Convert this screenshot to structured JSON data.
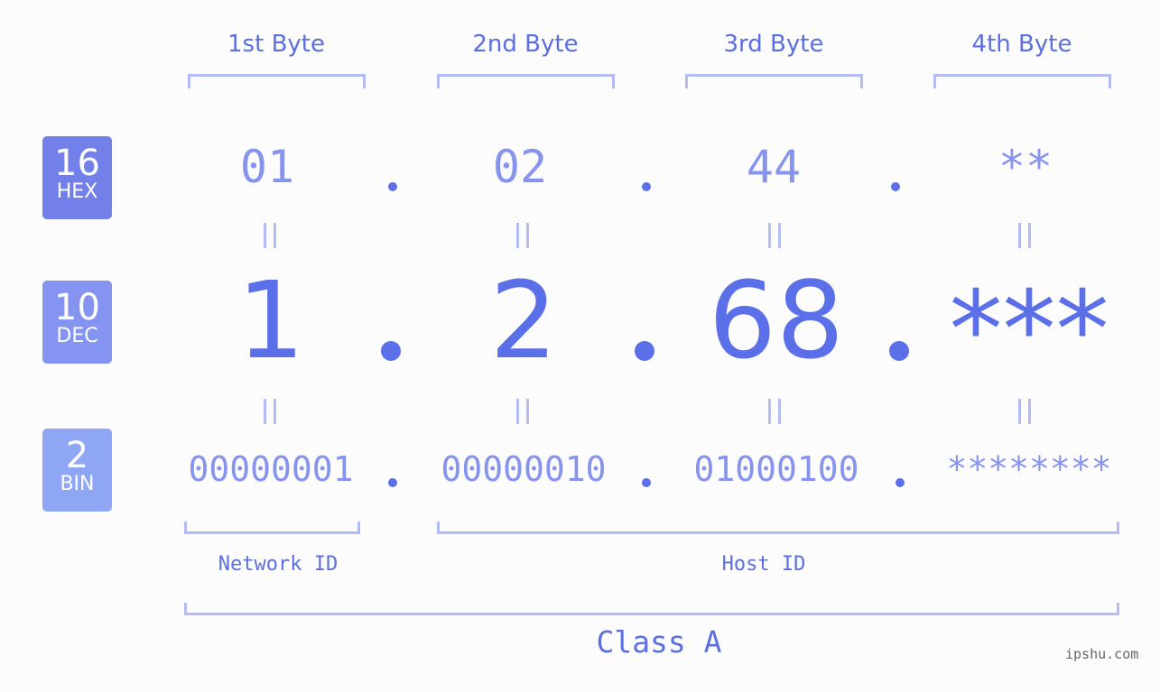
{
  "ip": {
    "hex": "01.02.44.**",
    "decimal": "1.2.68.***",
    "binary": "00000001.00000010.01000100.********"
  },
  "colors": {
    "accent": "#5b6fe8",
    "hex_badge": "#7480ea",
    "dec_badge": "#8494f0",
    "bin_badge": "#8fa6f5",
    "bracket": "#b3bcf5",
    "light_text": "#8794ee"
  },
  "badges": [
    {
      "number": "16",
      "label": "HEX"
    },
    {
      "number": "10",
      "label": "DEC"
    },
    {
      "number": "2",
      "label": "BIN"
    }
  ],
  "bytes": [
    {
      "header": "1st Byte",
      "hex": "01",
      "dec": "1",
      "bin": "00000001"
    },
    {
      "header": "2nd Byte",
      "hex": "02",
      "dec": "2",
      "bin": "00000010"
    },
    {
      "header": "3rd Byte",
      "hex": "44",
      "dec": "68",
      "bin": "01000100"
    },
    {
      "header": "4th Byte",
      "hex": "**",
      "dec": "***",
      "bin": "********"
    }
  ],
  "separator": ".",
  "network_id_label": "Network ID",
  "host_id_label": "Host ID",
  "class_label": "Class A",
  "watermark": "ipshu.com"
}
